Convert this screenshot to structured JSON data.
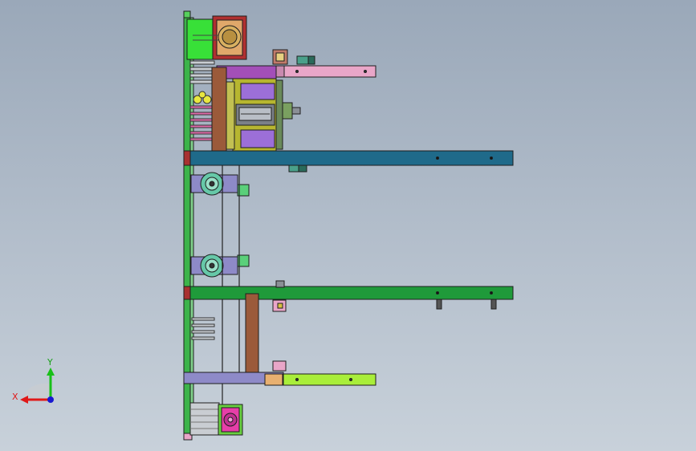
{
  "viewport": {
    "background_top": "#9aa8b9",
    "background_bottom": "#c8d1da"
  },
  "triad": {
    "x_label": "X",
    "y_label": "Y",
    "x_color": "#e01818",
    "y_color": "#18c018",
    "z_color": "#1818d0"
  },
  "colors": {
    "frame_green": "#3cb44a",
    "outline": "#1e1e1e",
    "beam_blue": "#1f6a8a",
    "beam_green": "#1f9a3a",
    "purple": "#a34fb8",
    "olive": "#b7b630",
    "brown": "#9b5a3a",
    "violet": "#9c6fd8",
    "pink": "#e9a6c8",
    "lavender": "#8e8ac8",
    "lime": "#a9ee3a",
    "teal": "#66c8a8",
    "magenta": "#e63fa8",
    "rail_grey": "#8a8f96"
  }
}
